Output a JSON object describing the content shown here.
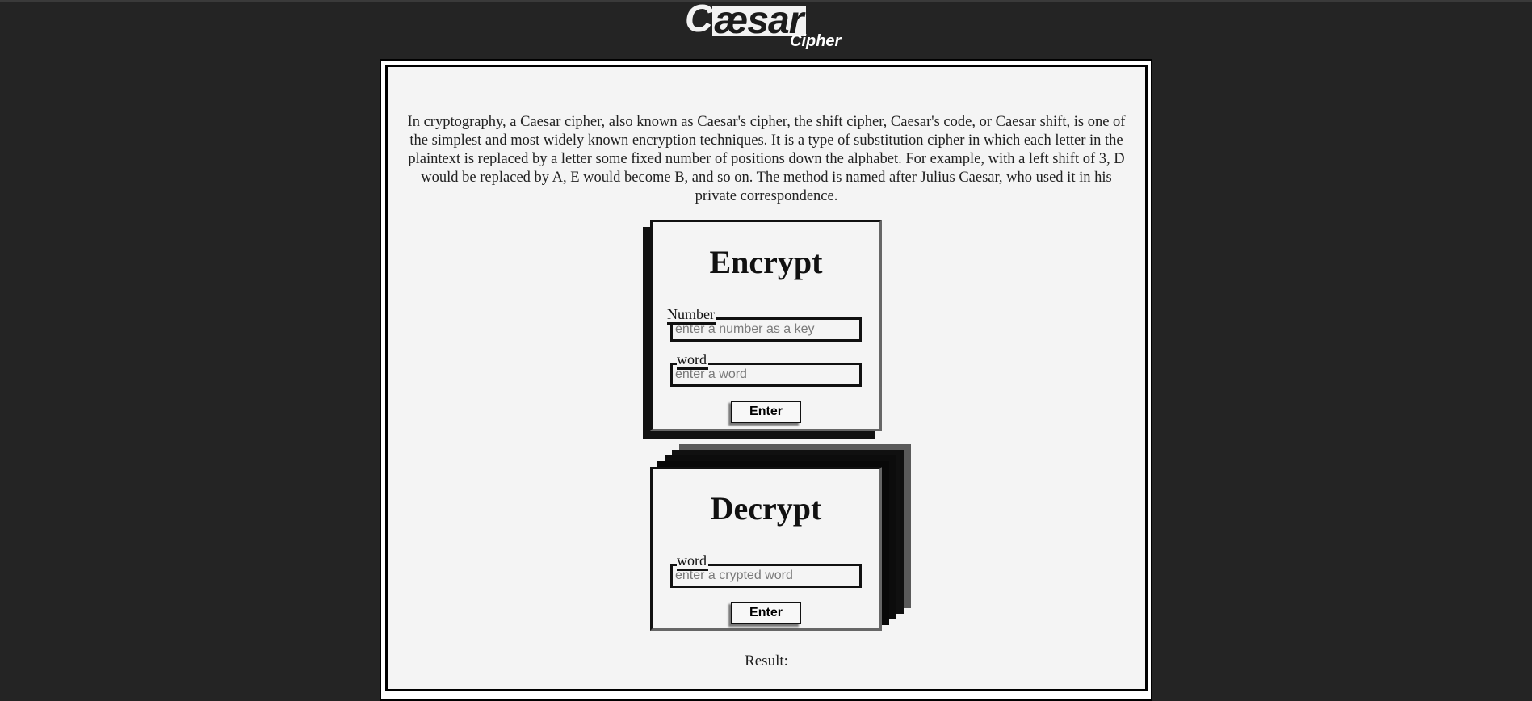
{
  "logo": {
    "text_c": "C",
    "text_ae": "æ",
    "text_rest": "sar",
    "sub": "Cipher"
  },
  "intro": "In cryptography, a Caesar cipher, also known as Caesar's cipher, the shift cipher, Caesar's code, or Caesar shift, is one of the simplest and most widely known encryption techniques. It is a type of substitution cipher in which each letter in the plaintext is replaced by a letter some fixed number of positions down the alphabet. For example, with a left shift of 3, D would be replaced by A, E would become B, and so on. The method is named after Julius Caesar, who used it in his private correspondence.",
  "encrypt": {
    "title": "Encrypt",
    "number_label": "Number",
    "number_placeholder": "enter a number as a key",
    "word_label": "word",
    "word_placeholder": "enter a word",
    "button": "Enter"
  },
  "decrypt": {
    "title": "Decrypt",
    "word_label": "word",
    "word_placeholder": "enter a crypted word",
    "button": "Enter"
  },
  "result": {
    "label": "Result:",
    "value": ""
  },
  "colors": {
    "background": "#242424",
    "panel": "#f4f4f4",
    "border": "#111111"
  }
}
